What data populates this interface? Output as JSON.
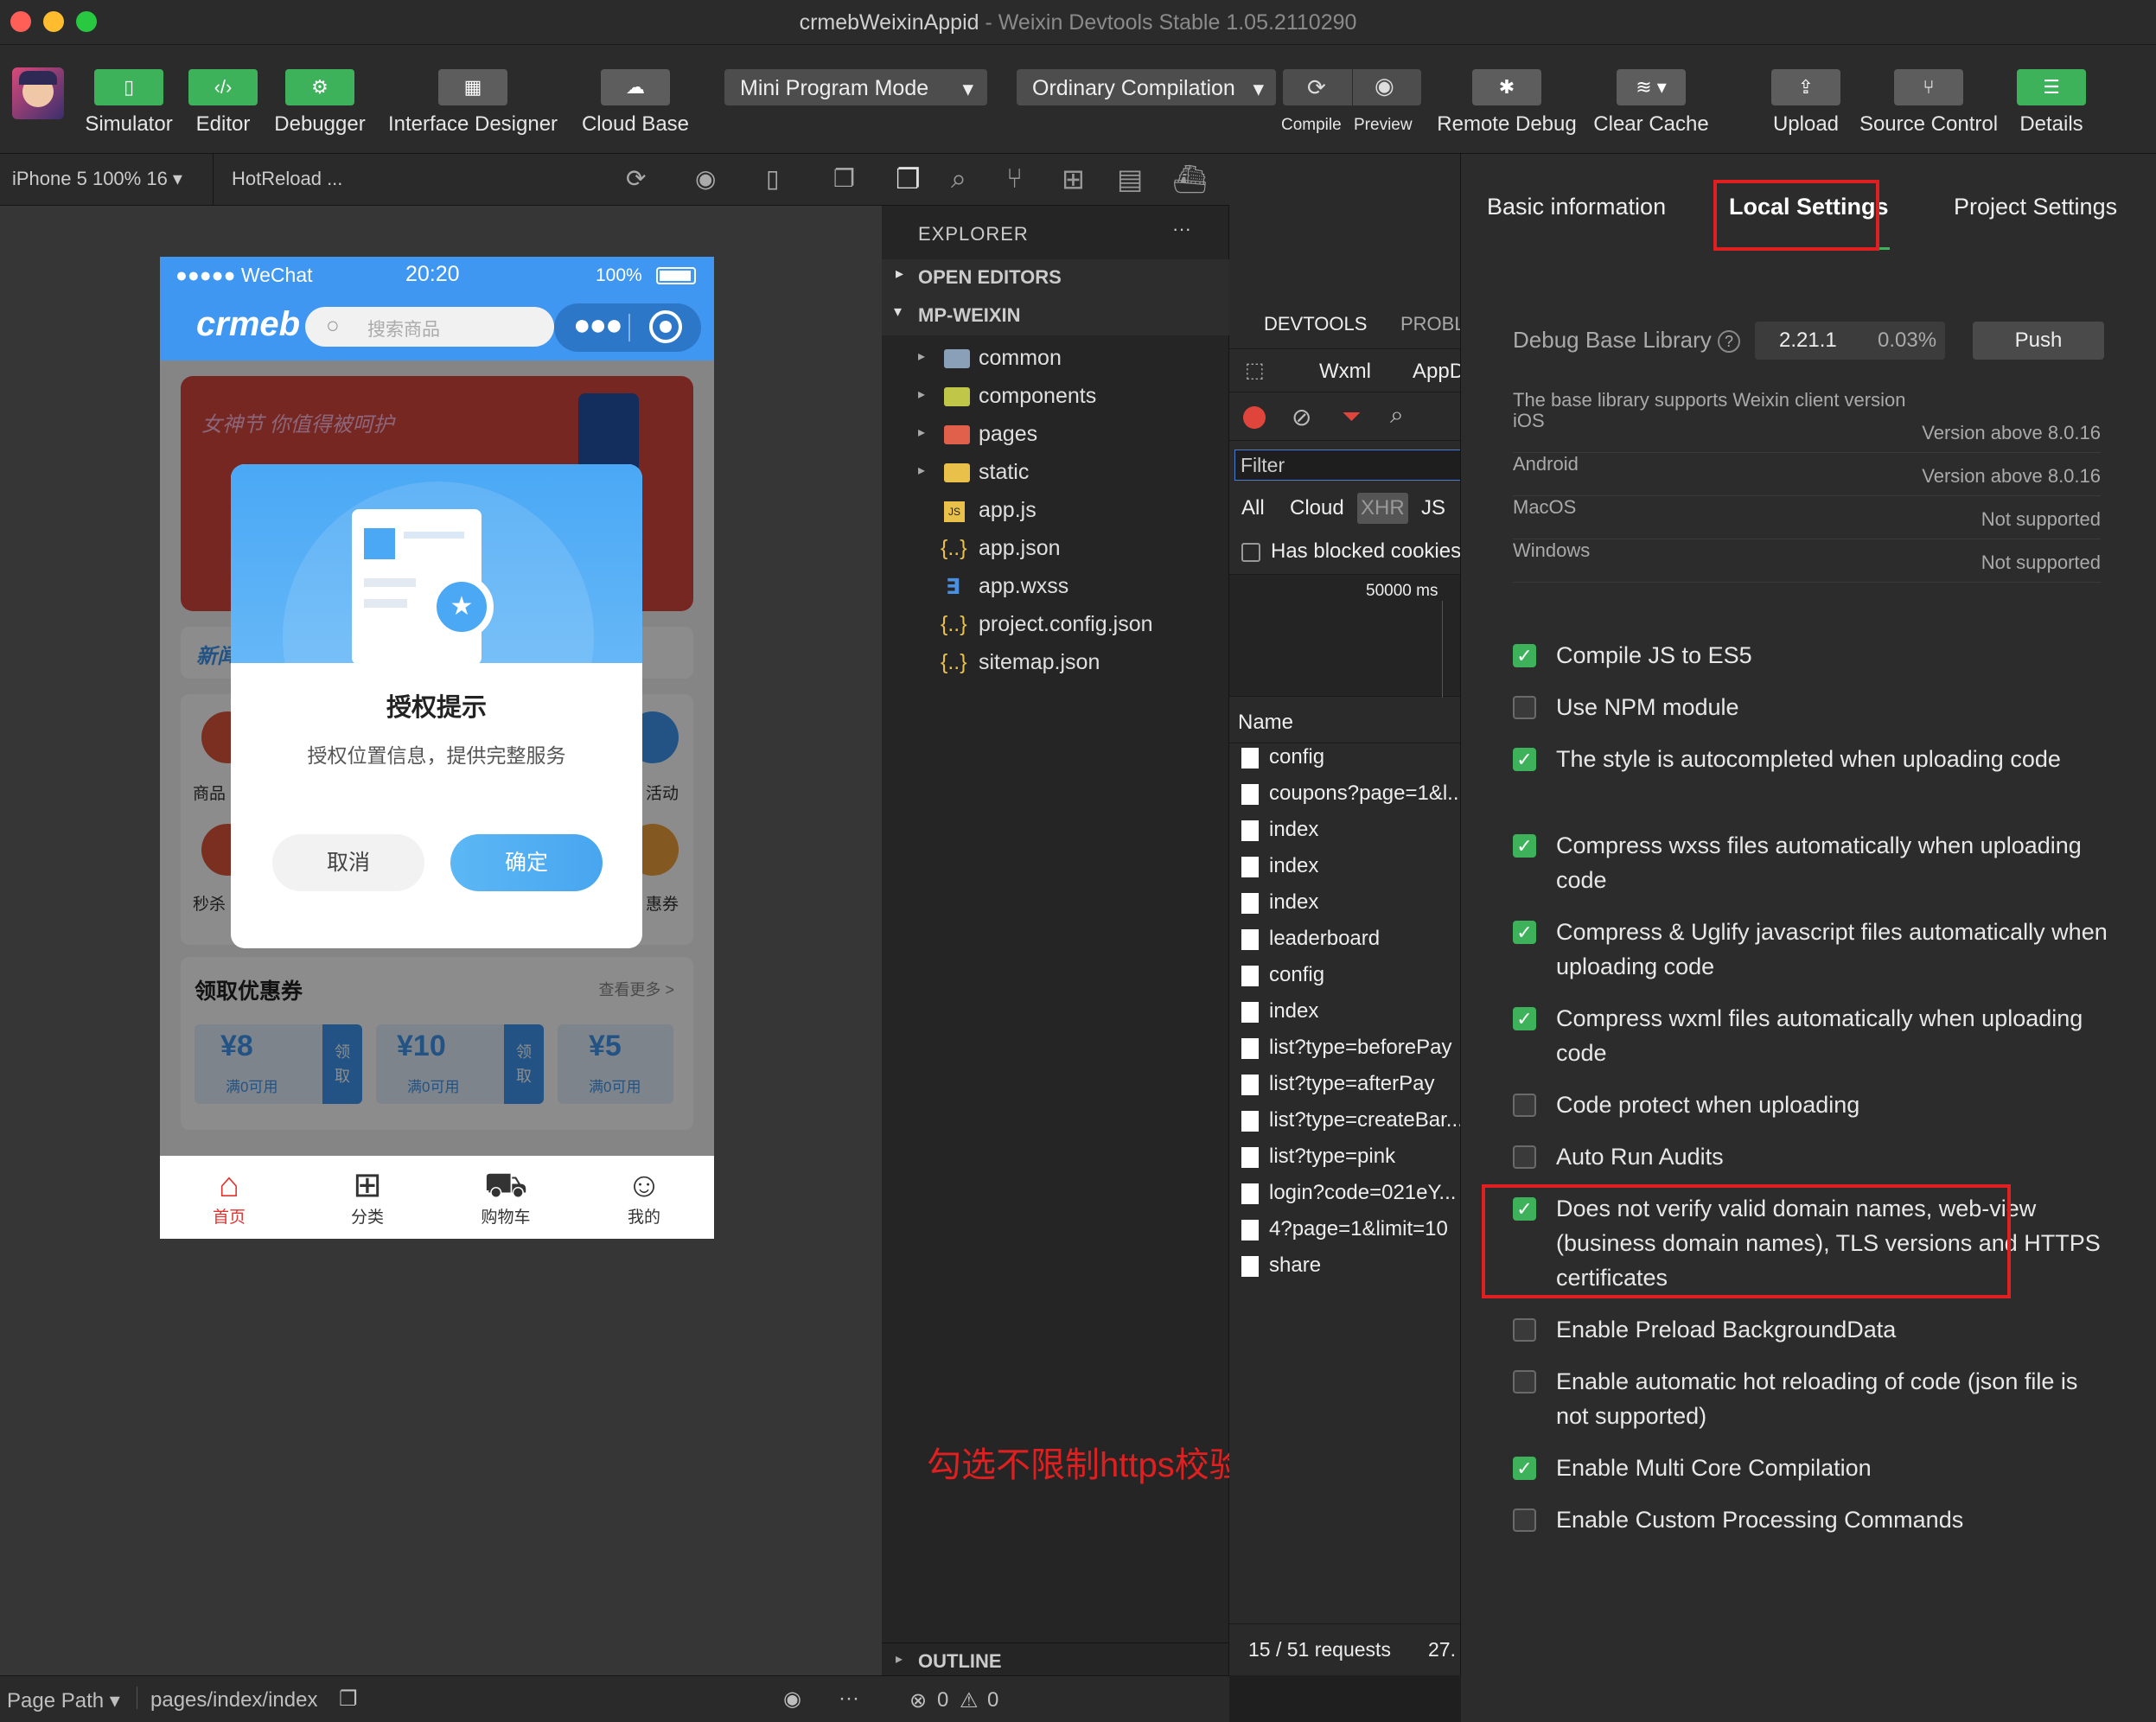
{
  "window": {
    "title": "crmebWeixinAppid",
    "subtitle": "Weixin Devtools Stable 1.05.2110290"
  },
  "toolbar": {
    "simulator": "Simulator",
    "editor": "Editor",
    "debugger": "Debugger",
    "interface_designer": "Interface Designer",
    "cloud_base": "Cloud Base",
    "mode": "Mini Program Mode",
    "compilation": "Ordinary Compilation",
    "compile": "Compile",
    "preview": "Preview",
    "remote_debug": "Remote Debug",
    "clear_cache": "Clear Cache",
    "upload": "Upload",
    "source_control": "Source Control",
    "details": "Details"
  },
  "simulator": {
    "device": "iPhone 5 100% 16 ▾",
    "hotreload": "HotReload ...",
    "status": {
      "carrier": "●●●●● WeChat",
      "time": "20:20",
      "battery": "100%"
    },
    "logo": "crmeb",
    "search_placeholder": "搜索商品",
    "banner_text": "女神节 你值得被呵护",
    "news": "新闻",
    "grid_labels": [
      "商品",
      "活动",
      "秒杀",
      "惠券"
    ],
    "coupon_title": "领取优惠券",
    "coupon_more": "查看更多 >",
    "coupons": [
      {
        "value": "¥8",
        "cond": "满0可用",
        "btn": "领取"
      },
      {
        "value": "¥10",
        "cond": "满0可用",
        "btn": "领取"
      },
      {
        "value": "¥5",
        "cond": "满0可用",
        "btn": ""
      }
    ],
    "dialog": {
      "title": "授权提示",
      "message": "授权位置信息，提供完整服务",
      "cancel": "取消",
      "confirm": "确定"
    },
    "tabs": [
      "首页",
      "分类",
      "购物车",
      "我的"
    ]
  },
  "explorer": {
    "title": "EXPLORER",
    "more": "···",
    "open_editors": "OPEN EDITORS",
    "project": "MP-WEIXIN",
    "items": [
      {
        "name": "common",
        "type": "folder"
      },
      {
        "name": "components",
        "type": "folder"
      },
      {
        "name": "pages",
        "type": "folder"
      },
      {
        "name": "static",
        "type": "folder"
      },
      {
        "name": "app.js",
        "type": "js"
      },
      {
        "name": "app.json",
        "type": "json"
      },
      {
        "name": "app.wxss",
        "type": "css"
      },
      {
        "name": "project.config.json",
        "type": "json"
      },
      {
        "name": "sitemap.json",
        "type": "json"
      }
    ],
    "outline": "OUTLINE"
  },
  "devtools": {
    "tab_devtools": "DEVTOOLS",
    "tab_problems": "PROBL",
    "subtabs": [
      "Wxml",
      "AppD"
    ],
    "filter_placeholder": "Filter",
    "types": [
      "All",
      "Cloud",
      "XHR",
      "JS"
    ],
    "blocked_cookies": "Has blocked cookies",
    "timeline_label": "50000 ms",
    "name_header": "Name",
    "requests": [
      "config",
      "coupons?page=1&l...",
      "index",
      "index",
      "index",
      "leaderboard",
      "config",
      "index",
      "list?type=beforePay",
      "list?type=afterPay",
      "list?type=createBar...",
      "list?type=pink",
      "login?code=021eY...",
      "4?page=1&limit=10",
      "share"
    ],
    "summary": "15 / 51 requests",
    "summary_size": "27."
  },
  "settings": {
    "tabs": [
      "Basic information",
      "Local Settings",
      "Project Settings"
    ],
    "debug_label": "Debug Base Library",
    "debug_version": "2.21.1",
    "debug_percent": "0.03%",
    "push": "Push",
    "support_text": "The base library supports Weixin client version",
    "support_rows": [
      {
        "os": "iOS",
        "req": "Version above 8.0.16"
      },
      {
        "os": "Android",
        "req": "Version above 8.0.16"
      },
      {
        "os": "MacOS",
        "req": "Not supported"
      },
      {
        "os": "Windows",
        "req": "Not supported"
      }
    ],
    "options": [
      {
        "label": "Compile JS to ES5",
        "checked": true
      },
      {
        "label": "Use NPM module",
        "checked": false
      },
      {
        "label": "The style is autocompleted when uploading code",
        "checked": true
      },
      {
        "label": "Compress wxss files automatically when uploading code",
        "checked": true
      },
      {
        "label": "Compress & Uglify javascript files automatically when uploading code",
        "checked": true
      },
      {
        "label": "Compress wxml files automatically when uploading code",
        "checked": true
      },
      {
        "label": "Code protect when uploading",
        "checked": false
      },
      {
        "label": "Auto Run Audits",
        "checked": false
      },
      {
        "label": "Does not verify valid domain names, web-view (business domain names), TLS versions and HTTPS certificates",
        "checked": true
      },
      {
        "label": "Enable Preload BackgroundData",
        "checked": false
      },
      {
        "label": "Enable automatic hot reloading of code (json file is not supported)",
        "checked": false
      },
      {
        "label": "Enable Multi Core Compilation",
        "checked": true
      },
      {
        "label": "Enable Custom Processing Commands",
        "checked": false
      }
    ]
  },
  "annotation": "勾选不限制https校验",
  "statusbar": {
    "page_path": "Page Path ▾",
    "path": "pages/index/index",
    "errors": "0",
    "warnings": "0"
  },
  "colors": {
    "accent_green": "#3eb25b",
    "highlight_red": "#e02020",
    "phone_blue": "#3f97f1"
  }
}
